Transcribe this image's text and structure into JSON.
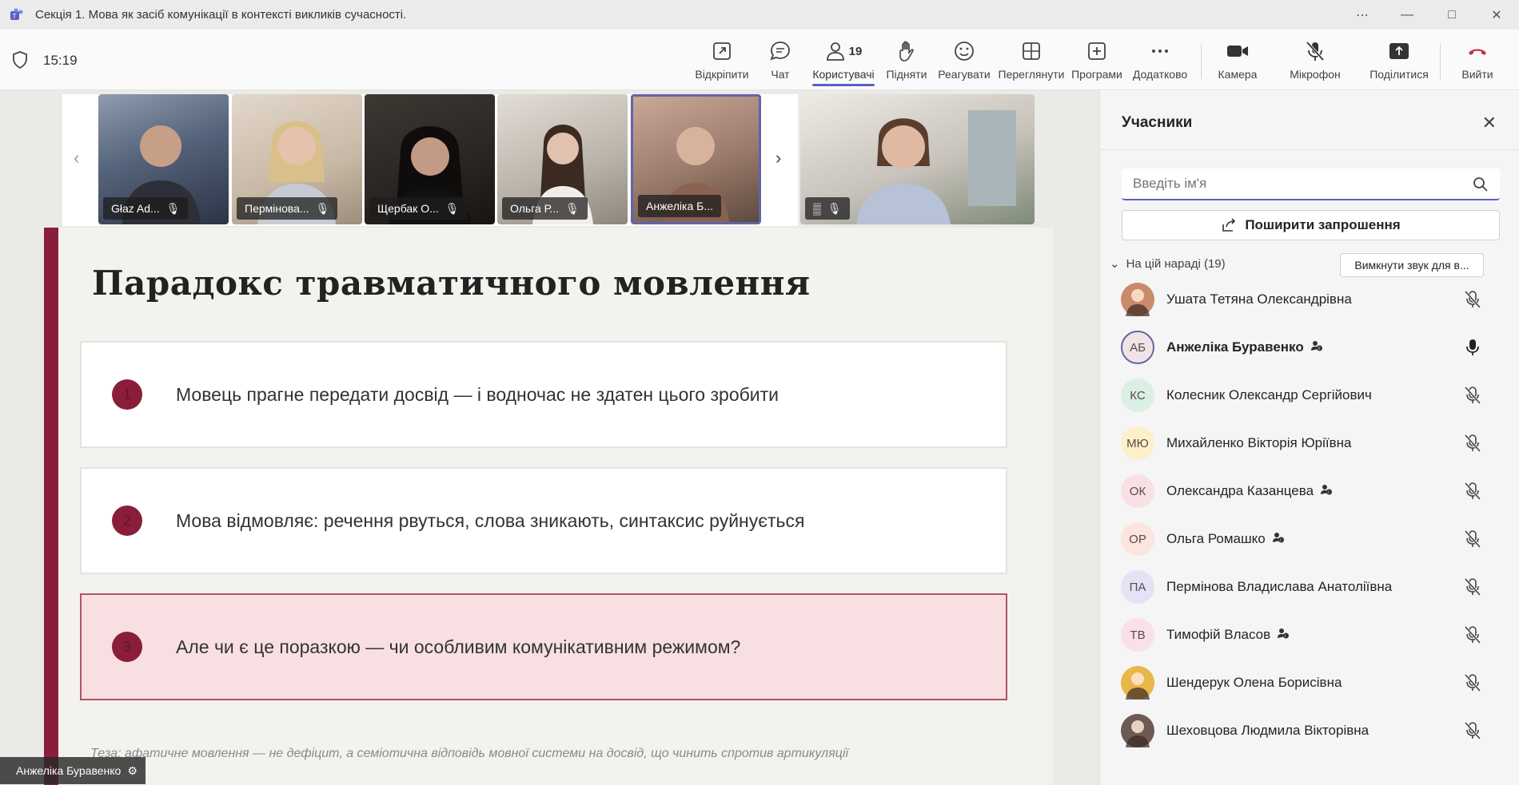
{
  "window": {
    "title": "Секція 1. Мова як засіб комунікації в контексті викликів сучасності.",
    "controls": [
      "more",
      "minimize",
      "maximize",
      "close"
    ]
  },
  "toolbar": {
    "time": "15:19",
    "buttons": [
      {
        "id": "popout",
        "label": "Відкріпити"
      },
      {
        "id": "chat",
        "label": "Чат"
      },
      {
        "id": "people",
        "label": "Користувачі",
        "count": "19"
      },
      {
        "id": "raise",
        "label": "Підняти"
      },
      {
        "id": "react",
        "label": "Реагувати"
      },
      {
        "id": "view",
        "label": "Переглянути"
      },
      {
        "id": "apps",
        "label": "Програми"
      },
      {
        "id": "more",
        "label": "Додатково"
      },
      {
        "id": "camera",
        "label": "Камера"
      },
      {
        "id": "mic",
        "label": "Мікрофон"
      },
      {
        "id": "share",
        "label": "Поділитися"
      },
      {
        "id": "leave",
        "label": "Вийти"
      }
    ]
  },
  "thumbnails": [
    {
      "name": "Głaz Ad...",
      "color": "#6b7a8f"
    },
    {
      "name": "Пермінова...",
      "color": "#c8b8a6"
    },
    {
      "name": "Щербак О...",
      "color": "#2f2a26"
    },
    {
      "name": "Ольга Р...",
      "color": "#b9b2a8"
    },
    {
      "name": "Анжеліка Б...",
      "color": "#9a7a6a"
    },
    {
      "name": "",
      "color": "#c7c2ba"
    }
  ],
  "slide": {
    "title": "Парадокс травматичного мовлення",
    "items": [
      {
        "num": "1",
        "text": "Мовець прагне передати досвід — і водночас не здатен цього зробити"
      },
      {
        "num": "2",
        "text": "Мова відмовляє: речення рвуться, слова зникають, синтаксис руйнується"
      },
      {
        "num": "3",
        "text": "Але чи є це поразкою — чи особливим комунікативним режимом?"
      }
    ],
    "thesis": "Теза: афатичне мовлення — не дефіцит, а семіотична відповідь мовної системи на досвід, що чинить спротив артикуляції"
  },
  "speaker": "Анжеліка Буравенко",
  "panel": {
    "title": "Учасники",
    "search_placeholder": "Введіть ім'я",
    "share_label": "Поширити запрошення",
    "group_label": "На цій нараді (19)",
    "mute_all_label": "Вимкнути звук для в...",
    "participants": [
      {
        "initials": "",
        "name": "Ушата Тетяна Олександрівна",
        "avatar_color": "#c98b6b",
        "photo": true,
        "org": false,
        "bold": false,
        "mic": "muted"
      },
      {
        "initials": "АБ",
        "name": "Анжеліка Буравенко",
        "avatar_color": "#f1e4e6",
        "photo": false,
        "org": true,
        "bold": true,
        "mic": "on"
      },
      {
        "initials": "КС",
        "name": "Колесник Олександр Сергійович",
        "avatar_color": "#dcefe4",
        "photo": false,
        "org": false,
        "bold": false,
        "mic": "muted"
      },
      {
        "initials": "МЮ",
        "name": "Михайленко Вікторія Юріївна",
        "avatar_color": "#fbf0c9",
        "photo": false,
        "org": false,
        "bold": false,
        "mic": "muted"
      },
      {
        "initials": "ОК",
        "name": "Олександра Казанцева",
        "avatar_color": "#f9e0e4",
        "photo": false,
        "org": true,
        "bold": false,
        "mic": "muted"
      },
      {
        "initials": "ОР",
        "name": "Ольга Ромашко",
        "avatar_color": "#fbe5dc",
        "photo": false,
        "org": true,
        "bold": false,
        "mic": "muted"
      },
      {
        "initials": "ПА",
        "name": "Пермінова Владислава Анатоліївна",
        "avatar_color": "#e4e3f5",
        "photo": false,
        "org": false,
        "bold": false,
        "mic": "muted"
      },
      {
        "initials": "ТВ",
        "name": "Тимофій Власов",
        "avatar_color": "#f9e0ea",
        "photo": false,
        "org": true,
        "bold": false,
        "mic": "muted"
      },
      {
        "initials": "",
        "name": "Шендерук Олена Борисівна",
        "avatar_color": "#e8b74a",
        "photo": true,
        "org": false,
        "bold": false,
        "mic": "muted"
      },
      {
        "initials": "",
        "name": "Шеховцова Людмила Вікторівна",
        "avatar_color": "#6d5a55",
        "photo": true,
        "org": false,
        "bold": false,
        "mic": "muted"
      }
    ]
  }
}
